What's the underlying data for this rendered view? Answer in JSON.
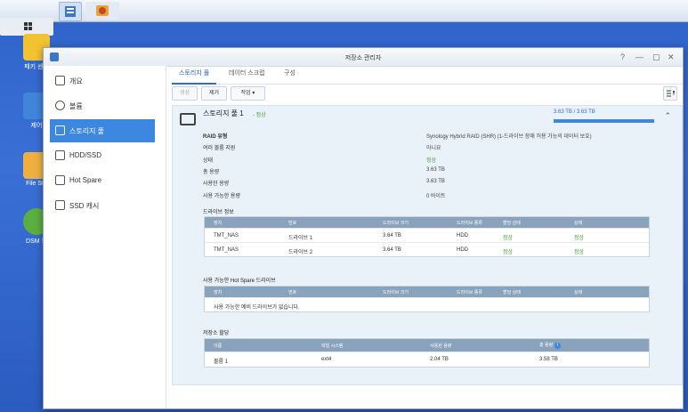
{
  "window": {
    "title": "저장소 관리자",
    "controls": [
      "?",
      "—",
      "▢",
      "✕"
    ]
  },
  "desktop_icons": [
    {
      "label": "패키\n센터",
      "icon": "package-center-icon"
    },
    {
      "label": "제어",
      "icon": "control-panel-icon"
    },
    {
      "label": "File Sta",
      "icon": "folder-icon"
    },
    {
      "label": "DSM 도",
      "icon": "help-icon"
    }
  ],
  "sidebar": {
    "items": [
      {
        "label": "개요",
        "icon": "overview-icon"
      },
      {
        "label": "볼륨",
        "icon": "volume-icon"
      },
      {
        "label": "스토리지 풀",
        "icon": "storage-pool-icon",
        "active": true
      },
      {
        "label": "HDD/SSD",
        "icon": "hdd-icon"
      },
      {
        "label": "Hot Spare",
        "icon": "hot-spare-icon"
      },
      {
        "label": "SSD 캐시",
        "icon": "ssd-cache-icon"
      }
    ]
  },
  "tabs": [
    "스토리지 풀",
    "데이터 스크럽",
    "구성"
  ],
  "toolbar": {
    "create": "생성",
    "remove": "제거",
    "action": "작업 ▾"
  },
  "pool": {
    "title": "스토리지 풀 1",
    "status": "- 정상",
    "capacity_text": "3.63 TB / 3.63 TB",
    "capacity_used_fraction": 1.0,
    "properties": [
      {
        "label": "RAID 유형",
        "value": "Synology Hybrid RAID (SHR) (1-드라이브 장애 허용 가능의 데이터 보호)",
        "bold": true
      },
      {
        "label": "여러 볼륨 지원",
        "value": "아니요"
      },
      {
        "label": "상태",
        "value": "정상",
        "ok": true
      },
      {
        "label": "총 용량",
        "value": "3.63 TB"
      },
      {
        "label": "사용한 용량",
        "value": "3.63 TB"
      },
      {
        "label": "사용 가능한 용량",
        "value": "0 바이트"
      }
    ]
  },
  "drive_info": {
    "title": "드라이브 정보",
    "headers": [
      "장치",
      "번호",
      "드라이브 크기",
      "드라이브 종류",
      "할당 상태",
      "상태"
    ],
    "rows": [
      [
        "TMT_NAS",
        "드라이브 1",
        "3.64 TB",
        "HDD",
        "정상",
        "정상"
      ],
      [
        "TMT_NAS",
        "드라이브 2",
        "3.64 TB",
        "HDD",
        "정상",
        "정상"
      ]
    ]
  },
  "hot_spare": {
    "title": "사용 가능한 Hot Spare 드라이브",
    "headers": [
      "장치",
      "번호",
      "드라이브 크기",
      "드라이브 종류",
      "할당 상태",
      "상태"
    ],
    "empty_text": "사용 가능한 예비 드라이브가 없습니다."
  },
  "storage_alloc": {
    "title": "저장소 할당",
    "headers": [
      "이름",
      "파일 시스템",
      "사용된 용량",
      "총 용량"
    ],
    "rows": [
      [
        "볼륨 1",
        "ext4",
        "2.04 TB",
        "3.58 TB"
      ]
    ]
  }
}
